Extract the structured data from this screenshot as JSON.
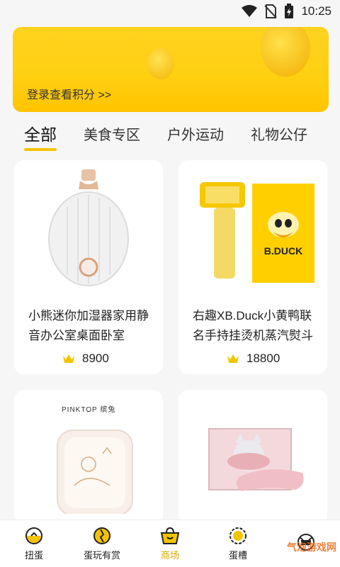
{
  "status_bar": {
    "time": "10:25",
    "icons": [
      "wifi-icon",
      "no-sim-icon",
      "battery-charging-icon"
    ]
  },
  "banner": {
    "link_text": "登录查看积分 >>"
  },
  "tabs": [
    {
      "label": "全部",
      "active": true
    },
    {
      "label": "美食专区",
      "active": false
    },
    {
      "label": "户外运动",
      "active": false
    },
    {
      "label": "礼物公仔",
      "active": false
    }
  ],
  "products": [
    {
      "title": "小熊迷你加湿器家用静音办公室桌面卧室",
      "points": "8900",
      "image": "humidifier-image"
    },
    {
      "title": "右趣XB.Duck小黄鸭联名手持挂烫机蒸汽熨斗",
      "points": "18800",
      "image": "steamer-image",
      "brand_text": "B.DUCK"
    },
    {
      "title": "",
      "points": "",
      "image": "lunchbox-image",
      "brand_text": "PINKTOP 缤兔"
    },
    {
      "title": "",
      "points": "",
      "image": "eye-mask-image"
    }
  ],
  "bottom_nav": [
    {
      "label": "扭蛋",
      "icon": "gashapon-icon",
      "active": false
    },
    {
      "label": "蛋玩有赏",
      "icon": "egg-reward-icon",
      "active": false
    },
    {
      "label": "商场",
      "icon": "shop-basket-icon",
      "active": true
    },
    {
      "label": "蛋槽",
      "icon": "egg-slot-icon",
      "active": false
    },
    {
      "label": "",
      "icon": "profile-icon",
      "active": false
    }
  ],
  "watermark": "气泡游戏网",
  "colors": {
    "accent": "#f7c400",
    "banner": "#ffd21f",
    "active_nav": "#e0a800"
  }
}
